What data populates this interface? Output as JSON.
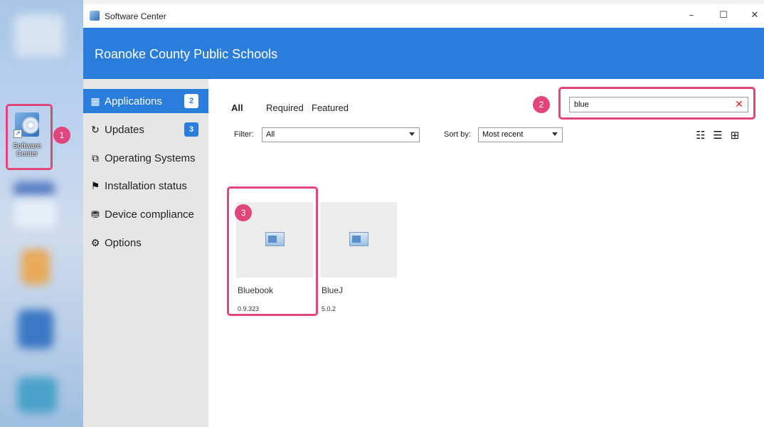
{
  "desktop": {
    "icon_label": "Software Center"
  },
  "window": {
    "title": "Software Center",
    "controls": {
      "minimize": "–",
      "maximize": "☐",
      "close": "✕"
    }
  },
  "banner": {
    "org_name": "Roanoke County Public Schools"
  },
  "sidebar": {
    "items": [
      {
        "label": "Applications",
        "icon": "grid-icon",
        "glyph": "▦",
        "badge": "2",
        "active": true
      },
      {
        "label": "Updates",
        "icon": "refresh-icon",
        "glyph": "↻",
        "badge": "3",
        "active": false
      },
      {
        "label": "Operating Systems",
        "icon": "windows-stack-icon",
        "glyph": "⧉",
        "badge": "",
        "active": false
      },
      {
        "label": "Installation status",
        "icon": "flag-icon",
        "glyph": "⚑",
        "badge": "",
        "active": false
      },
      {
        "label": "Device compliance",
        "icon": "compliance-icon",
        "glyph": "⛃",
        "badge": "",
        "active": false
      },
      {
        "label": "Options",
        "icon": "gear-icon",
        "glyph": "⚙",
        "badge": "",
        "active": false
      }
    ]
  },
  "tabs": [
    {
      "label": "All",
      "selected": true
    },
    {
      "label": "Required",
      "selected": false
    },
    {
      "label": "Featured",
      "selected": false
    }
  ],
  "search": {
    "value": "blue",
    "clear_glyph": "✕"
  },
  "filter": {
    "label": "Filter:",
    "value": "All"
  },
  "sort": {
    "label": "Sort by:",
    "value": "Most recent"
  },
  "view_toggles": [
    {
      "icon": "checklist-view-icon",
      "glyph": "☷"
    },
    {
      "icon": "list-view-icon",
      "glyph": "☰"
    },
    {
      "icon": "tile-view-icon",
      "glyph": "⊞"
    }
  ],
  "apps": [
    {
      "name": "Bluebook",
      "version": "0.9.323"
    },
    {
      "name": "BlueJ",
      "version": "5.0.2"
    }
  ],
  "callouts": [
    "1",
    "2",
    "3"
  ],
  "colors": {
    "accent": "#2b7ddb",
    "highlight": "#e0457b",
    "clear": "#e01b24"
  }
}
